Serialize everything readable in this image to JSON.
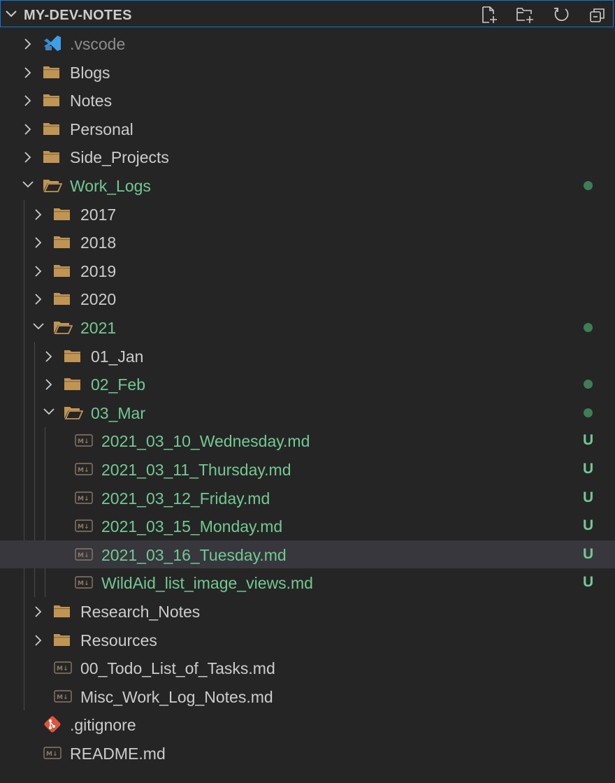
{
  "explorer": {
    "title": "MY-DEV-NOTES",
    "actions": [
      "new-file-icon",
      "new-folder-icon",
      "refresh-icon",
      "collapse-all-icon"
    ]
  },
  "tree": [
    {
      "label": ".vscode",
      "kind": "vscode",
      "expanded": false,
      "depth": 0,
      "dim": true
    },
    {
      "label": "Blogs",
      "kind": "folder",
      "expanded": false,
      "depth": 0
    },
    {
      "label": "Notes",
      "kind": "folder",
      "expanded": false,
      "depth": 0
    },
    {
      "label": "Personal",
      "kind": "folder",
      "expanded": false,
      "depth": 0
    },
    {
      "label": "Side_Projects",
      "kind": "folder",
      "expanded": false,
      "depth": 0
    },
    {
      "label": "Work_Logs",
      "kind": "folder",
      "expanded": true,
      "depth": 0,
      "green": true,
      "dot": true
    },
    {
      "label": "2017",
      "kind": "folder",
      "expanded": false,
      "depth": 1
    },
    {
      "label": "2018",
      "kind": "folder",
      "expanded": false,
      "depth": 1
    },
    {
      "label": "2019",
      "kind": "folder",
      "expanded": false,
      "depth": 1
    },
    {
      "label": "2020",
      "kind": "folder",
      "expanded": false,
      "depth": 1
    },
    {
      "label": "2021",
      "kind": "folder",
      "expanded": true,
      "depth": 1,
      "green": true,
      "dot": true
    },
    {
      "label": "01_Jan",
      "kind": "folder",
      "expanded": false,
      "depth": 2
    },
    {
      "label": "02_Feb",
      "kind": "folder",
      "expanded": false,
      "depth": 2,
      "green": true,
      "dot": true
    },
    {
      "label": "03_Mar",
      "kind": "folder",
      "expanded": true,
      "depth": 2,
      "green": true,
      "dot": true
    },
    {
      "label": "2021_03_10_Wednesday.md",
      "kind": "md",
      "depth": 3,
      "green": true,
      "badge": "U"
    },
    {
      "label": "2021_03_11_Thursday.md",
      "kind": "md",
      "depth": 3,
      "green": true,
      "badge": "U"
    },
    {
      "label": "2021_03_12_Friday.md",
      "kind": "md",
      "depth": 3,
      "green": true,
      "badge": "U"
    },
    {
      "label": "2021_03_15_Monday.md",
      "kind": "md",
      "depth": 3,
      "green": true,
      "badge": "U"
    },
    {
      "label": "2021_03_16_Tuesday.md",
      "kind": "md",
      "depth": 3,
      "green": true,
      "badge": "U",
      "selected": true
    },
    {
      "label": "WildAid_list_image_views.md",
      "kind": "md",
      "depth": 3,
      "green": true,
      "badge": "U"
    },
    {
      "label": "Research_Notes",
      "kind": "folder",
      "expanded": false,
      "depth": 1
    },
    {
      "label": "Resources",
      "kind": "folder",
      "expanded": false,
      "depth": 1
    },
    {
      "label": "00_Todo_List_of_Tasks.md",
      "kind": "md",
      "depth": 1
    },
    {
      "label": "Misc_Work_Log_Notes.md",
      "kind": "md",
      "depth": 1
    },
    {
      "label": ".gitignore",
      "kind": "git",
      "depth": 0
    },
    {
      "label": "README.md",
      "kind": "md",
      "depth": 0
    }
  ],
  "colors": {
    "background": "#252526",
    "untracked": "#73c991",
    "folder": "#c09553",
    "selection": "#37373d",
    "focus_border": "#0a7bd8"
  }
}
